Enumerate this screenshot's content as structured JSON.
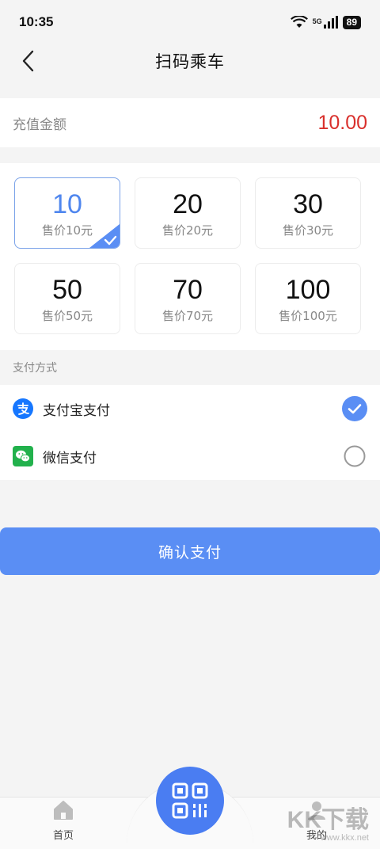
{
  "status_bar": {
    "time": "10:35",
    "network": "5G",
    "battery": "89"
  },
  "nav": {
    "title": "扫码乘车"
  },
  "amount": {
    "label": "充值金额",
    "value": "10.00"
  },
  "options": [
    {
      "value": "10",
      "price": "售价10元",
      "selected": true
    },
    {
      "value": "20",
      "price": "售价20元",
      "selected": false
    },
    {
      "value": "30",
      "price": "售价30元",
      "selected": false
    },
    {
      "value": "50",
      "price": "售价50元",
      "selected": false
    },
    {
      "value": "70",
      "price": "售价70元",
      "selected": false
    },
    {
      "value": "100",
      "price": "售价100元",
      "selected": false
    }
  ],
  "payment": {
    "header": "支付方式",
    "methods": [
      {
        "label": "支付宝支付",
        "icon": "alipay-icon",
        "selected": true
      },
      {
        "label": "微信支付",
        "icon": "wechat-pay-icon",
        "selected": false
      }
    ]
  },
  "confirm": {
    "label": "确认支付"
  },
  "tabs": [
    {
      "label": "首页",
      "icon": "home-icon"
    },
    {
      "label": "我的",
      "icon": "profile-icon"
    }
  ],
  "watermark": {
    "brand": "KK下载",
    "url": "www.kkx.net"
  },
  "colors": {
    "accent": "#5a8ef4",
    "amount": "#d9302c",
    "selected_border": "#7aa2e8"
  }
}
